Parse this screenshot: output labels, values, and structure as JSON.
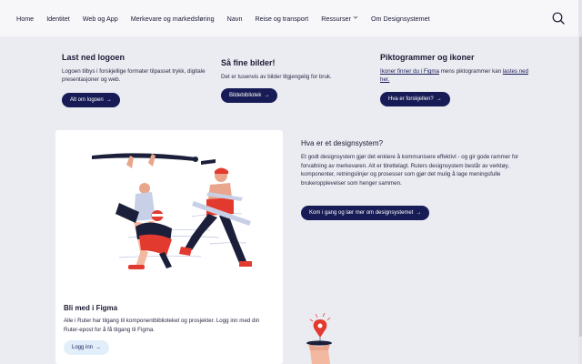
{
  "nav": {
    "items": [
      {
        "label": "Home"
      },
      {
        "label": "Identitet"
      },
      {
        "label": "Web og App"
      },
      {
        "label": "Merkevare og markedsføring"
      },
      {
        "label": "Navn"
      },
      {
        "label": "Reise og transport"
      },
      {
        "label": "Ressurser",
        "dropdown": true
      },
      {
        "label": "Om Designsystemet"
      }
    ],
    "search_icon": "search-icon"
  },
  "logo_section": {
    "title": "Last ned logoen",
    "text": "Logoen tilbys i forskjellige formater tilpasset trykk, digitale presentasjoner og web.",
    "button": "Alt om logoen"
  },
  "images_section": {
    "title": "Så fine bilder!",
    "text": "Det er tusenvis av bilder tilgjengelig for bruk.",
    "button": "Bildebibliotek"
  },
  "icons_section": {
    "title": "Piktogrammer og ikoner",
    "link1": "Ikoner finner du i Figma",
    "text_mid": " mens piktogrammer kan ",
    "link2": "lastes ned her.",
    "button": "Hva er forskjellen?"
  },
  "figma_card": {
    "title": "Bli med i Figma",
    "text": "Alle i Ruter har tilgang til komponentbiblioteket og prosjekter. Logg inn med din Ruter-epost for å få tilgang til Figma.",
    "button": "Logg inn"
  },
  "design_system": {
    "title": "Hva er et designsystem?",
    "text": "Et godt designsystem gjør det enkiere å kommunisere effektivt - og gir gode rammer for forvaltning av merkevaren. Alt er tilrettelagt. Ruters designsystem består av verktøy, komponenter, retningslinjer og prosesser som gjør det mulig å lage meningsfulle brukeropplevelser som henger sammen.",
    "button": "Kom i gang og lær mer om designsystemet"
  },
  "colors": {
    "primary": "#181c56",
    "page_bg": "#ebebf2",
    "accent_red": "#e23a2e",
    "light_button": "#e2effa"
  },
  "arrow_glyph": "→"
}
